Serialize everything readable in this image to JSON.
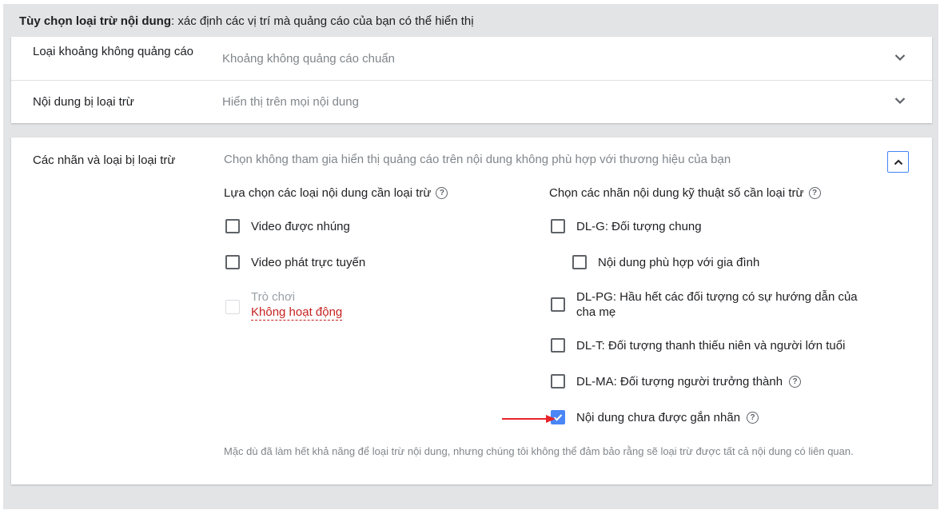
{
  "header": {
    "title_bold": "Tùy chọn loại trừ nội dung",
    "title_rest": ": xác định các vị trí mà quảng cáo của bạn có thể hiển thị"
  },
  "inventory_row": {
    "label": "Loại khoảng không quảng cáo",
    "value": "Khoảng không quảng cáo chuẩn"
  },
  "excluded_row": {
    "label": "Nội dung bị loại trừ",
    "value": "Hiển thị trên mọi nội dung"
  },
  "labels_section": {
    "label": "Các nhãn và loại bị loại trừ",
    "description": "Chọn không tham gia hiển thị quảng cáo trên nội dung không phù hợp với thương hiệu của bạn",
    "left_title": "Lựa chọn các loại nội dung cần loại trừ",
    "right_title": "Chọn các nhãn nội dung kỹ thuật số cần loại trừ",
    "left_items": [
      {
        "label": "Video được nhúng",
        "checked": false
      },
      {
        "label": "Video phát trực tuyến",
        "checked": false
      },
      {
        "label": "Trò chơi",
        "status": "Không hoạt động",
        "disabled": true
      }
    ],
    "right_items": [
      {
        "label": "DL-G: Đối tượng chung",
        "checked": false
      },
      {
        "label": "Nội dung phù hợp với gia đình",
        "checked": false
      },
      {
        "label": "DL-PG: Hầu hết các đối tượng có sự hướng dẫn của cha mẹ",
        "checked": false
      },
      {
        "label": "DL-T: Đối tượng thanh thiếu niên và người lớn tuổi",
        "checked": false
      },
      {
        "label": "DL-MA: Đối tượng người trưởng thành",
        "checked": false
      },
      {
        "label": "Nội dung chưa được gắn nhãn",
        "checked": true
      }
    ],
    "note": "Mặc dù đã làm hết khả năng để loại trừ nội dung, nhưng chúng tôi không thể đảm bảo rằng sẽ loại trừ được tất cả nội dung có liên quan."
  },
  "colors": {
    "accent": "#4a86f5",
    "arrow": "#e8232a",
    "inactive": "#c5221f"
  },
  "icons": {
    "help": "?",
    "expand": "chevron-down-icon",
    "collapse": "chevron-up-icon"
  }
}
